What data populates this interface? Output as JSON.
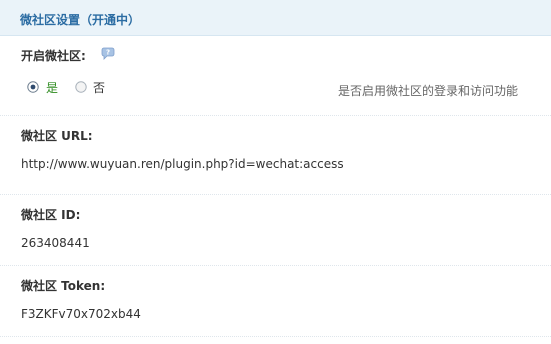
{
  "header": {
    "title": "微社区设置（开通中）"
  },
  "enable": {
    "label": "开启微社区:",
    "help_icon": "speech-bubble-question-icon",
    "options": [
      {
        "label": "是",
        "selected": true
      },
      {
        "label": "否",
        "selected": false
      }
    ],
    "hint": "是否启用微社区的登录和访问功能"
  },
  "url": {
    "label": "微社区 URL:",
    "value": "http://www.wuyuan.ren/plugin.php?id=wechat:access"
  },
  "id_field": {
    "label": "微社区 ID:",
    "value": "263408441"
  },
  "token": {
    "label": "微社区 Token:",
    "value": "F3ZKFv70x702xb44"
  },
  "colors": {
    "accent": "#2b6ca3",
    "header_bg": "#eaf3f9",
    "selected_text": "#2e8b1f"
  }
}
